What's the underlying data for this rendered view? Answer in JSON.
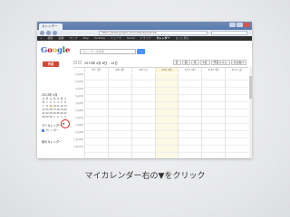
{
  "browser": {
    "tab_title": "カレンダー",
    "url": "https://www.google.com/calendar/render"
  },
  "gbar": {
    "items": [
      "+",
      "検索",
      "画像",
      "マップ",
      "Play",
      "YouTube",
      "ニュース",
      "Gmail",
      "ドライブ",
      "カレンダー",
      "もっと見る"
    ],
    "active_index": 9
  },
  "logo_letters": [
    "G",
    "o",
    "o",
    "g",
    "l",
    "e"
  ],
  "search": {
    "placeholder": "カレンダーを検索"
  },
  "toolbar": {
    "create_label": "作成",
    "date_range": "2013年 4月 8日 – 14日",
    "views": [
      "日",
      "週",
      "月",
      "4日",
      "予定リスト"
    ],
    "more_label": "その他 ▾"
  },
  "minical": {
    "title": "2013年 4月",
    "days": [
      "日",
      "月",
      "火",
      "水",
      "木",
      "金",
      "土"
    ],
    "dates": [
      "31",
      "1",
      "2",
      "3",
      "4",
      "5",
      "6",
      "7",
      "8",
      "9",
      "10",
      "11",
      "12",
      "13",
      "14",
      "15",
      "16",
      "17",
      "18",
      "19",
      "20",
      "21",
      "22",
      "23",
      "24",
      "25",
      "26",
      "27",
      "28",
      "29",
      "30",
      "1",
      "2",
      "3",
      "4"
    ],
    "today_index": 9
  },
  "sidebar": {
    "my_calendars": "マイカレンダー",
    "my_calendar_item": "カレンダー",
    "dropdown_arrow": "▼",
    "other_calendars": "他のカレンダー"
  },
  "week": {
    "day_headers": [
      "4/7 (日)",
      "4/8 (月)",
      "4/9 (火)",
      "4/10 (水)",
      "4/11 (木)",
      "4/12 (金)",
      "4/13 (土)"
    ],
    "today_index": 3,
    "times": [
      "午前1時",
      "午前2時",
      "午前3時",
      "午前4時",
      "午前5時",
      "午前6時",
      "午前7時",
      "午前8時",
      "午前9時",
      "午前10時",
      "午前11時"
    ]
  },
  "caption": "マイカレンダー右の▼をクリック",
  "colors": {
    "create_button": "#d14836",
    "highlight_circle": "#e0231c",
    "today_column": "#fef9e4"
  }
}
